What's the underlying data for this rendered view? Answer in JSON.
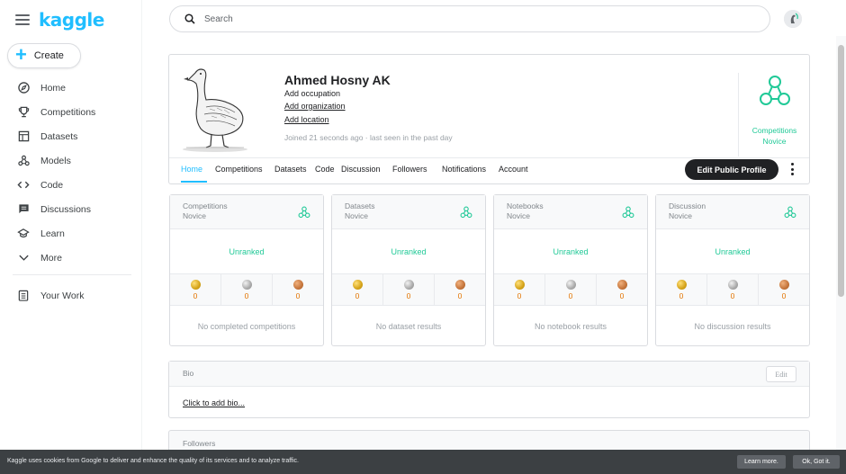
{
  "sidebar": {
    "logo": "kaggle",
    "create_label": "Create",
    "items": [
      {
        "label": "Home",
        "icon": "compass-icon"
      },
      {
        "label": "Competitions",
        "icon": "trophy-icon"
      },
      {
        "label": "Datasets",
        "icon": "table-icon"
      },
      {
        "label": "Models",
        "icon": "models-icon"
      },
      {
        "label": "Code",
        "icon": "code-icon"
      },
      {
        "label": "Discussions",
        "icon": "chat-icon"
      },
      {
        "label": "Learn",
        "icon": "graduation-cap-icon"
      },
      {
        "label": "More",
        "icon": "chevron-down-icon"
      }
    ],
    "your_work": "Your Work"
  },
  "search": {
    "placeholder": "Search"
  },
  "profile": {
    "name": "Ahmed Hosny AK",
    "add_occupation": "Add occupation",
    "add_organization": "Add organization",
    "add_location": "Add location",
    "joined": "Joined 21 seconds ago · last seen in the past day",
    "tier_line1": "Competitions",
    "tier_line2": "Novice",
    "tabs": [
      "Home",
      "Competitions",
      "Datasets",
      "Code",
      "Discussion",
      "Followers",
      "Notifications",
      "Account"
    ],
    "edit_button": "Edit Public Profile"
  },
  "cards": [
    {
      "title_1": "Competitions",
      "title_2": "Novice",
      "rank": "Unranked",
      "gold": "0",
      "silver": "0",
      "bronze": "0",
      "empty": "No completed competitions"
    },
    {
      "title_1": "Datasets",
      "title_2": "Novice",
      "rank": "Unranked",
      "gold": "0",
      "silver": "0",
      "bronze": "0",
      "empty": "No dataset results"
    },
    {
      "title_1": "Notebooks",
      "title_2": "Novice",
      "rank": "Unranked",
      "gold": "0",
      "silver": "0",
      "bronze": "0",
      "empty": "No notebook results"
    },
    {
      "title_1": "Discussion",
      "title_2": "Novice",
      "rank": "Unranked",
      "gold": "0",
      "silver": "0",
      "bronze": "0",
      "empty": "No discussion results"
    }
  ],
  "bio": {
    "title": "Bio",
    "edit": "Edit",
    "add": "Click to add bio..."
  },
  "followers": {
    "title": "Followers"
  },
  "cookie": {
    "text": "Kaggle uses cookies from Google to deliver and enhance the quality of its services and to analyze traffic.",
    "learn_more": "Learn more.",
    "ok": "Ok, Got it."
  },
  "colors": {
    "brand": "#20beff",
    "tier": "#20c997",
    "dark": "#202124"
  }
}
